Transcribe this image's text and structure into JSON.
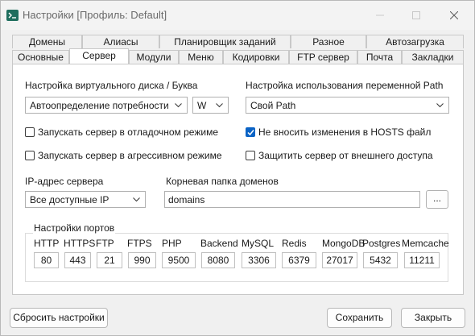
{
  "window": {
    "title": "Настройки [Профиль: Default]"
  },
  "tabs_back": [
    {
      "label": "Домены"
    },
    {
      "label": "Алиасы"
    },
    {
      "label": "Планировщик заданий"
    },
    {
      "label": "Разное"
    },
    {
      "label": "Автозагрузка"
    }
  ],
  "tabs_front": [
    {
      "label": "Основные",
      "active": false
    },
    {
      "label": "Сервер",
      "active": true
    },
    {
      "label": "Модули",
      "active": false
    },
    {
      "label": "Меню",
      "active": false
    },
    {
      "label": "Кодировки",
      "active": false
    },
    {
      "label": "FTP сервер",
      "active": false
    },
    {
      "label": "Почта",
      "active": false
    },
    {
      "label": "Закладки",
      "active": false
    }
  ],
  "server": {
    "vdisk_label": "Настройка виртуального диска / Буква",
    "vdisk_select": "Автоопределение потребности",
    "drive_letter": "W",
    "path_label": "Настройка использования переменной Path",
    "path_select": "Свой Path",
    "checkboxes": [
      {
        "label": "Запускать сервер в отладочном режиме",
        "checked": false
      },
      {
        "label": "Запускать сервер в агрессивном режиме",
        "checked": false
      },
      {
        "label": "Не вносить изменения в HOSTS файл",
        "checked": true
      },
      {
        "label": "Защитить сервер от внешнего доступа",
        "checked": false
      }
    ],
    "ip_label": "IP-адрес сервера",
    "ip_select": "Все доступные IP",
    "root_label": "Корневая папка доменов",
    "root_value": "domains",
    "browse_label": "..."
  },
  "ports": {
    "title": "Настройки портов",
    "items": [
      {
        "name": "HTTP",
        "value": "80"
      },
      {
        "name": "HTTPS",
        "value": "443"
      },
      {
        "name": "FTP",
        "value": "21"
      },
      {
        "name": "FTPS",
        "value": "990"
      },
      {
        "name": "PHP",
        "value": "9500"
      },
      {
        "name": "Backend",
        "value": "8080"
      },
      {
        "name": "MySQL",
        "value": "3306"
      },
      {
        "name": "Redis",
        "value": "6379"
      },
      {
        "name": "MongoDB",
        "value": "27017"
      },
      {
        "name": "Postgres",
        "value": "5432"
      },
      {
        "name": "Memcache",
        "value": "11211"
      }
    ]
  },
  "footer": {
    "reset_label": "Сбросить настройки",
    "save_label": "Сохранить",
    "close_label": "Закрыть"
  },
  "colors": {
    "accent": "#0b63c5",
    "icon": "#1f6e5e"
  }
}
